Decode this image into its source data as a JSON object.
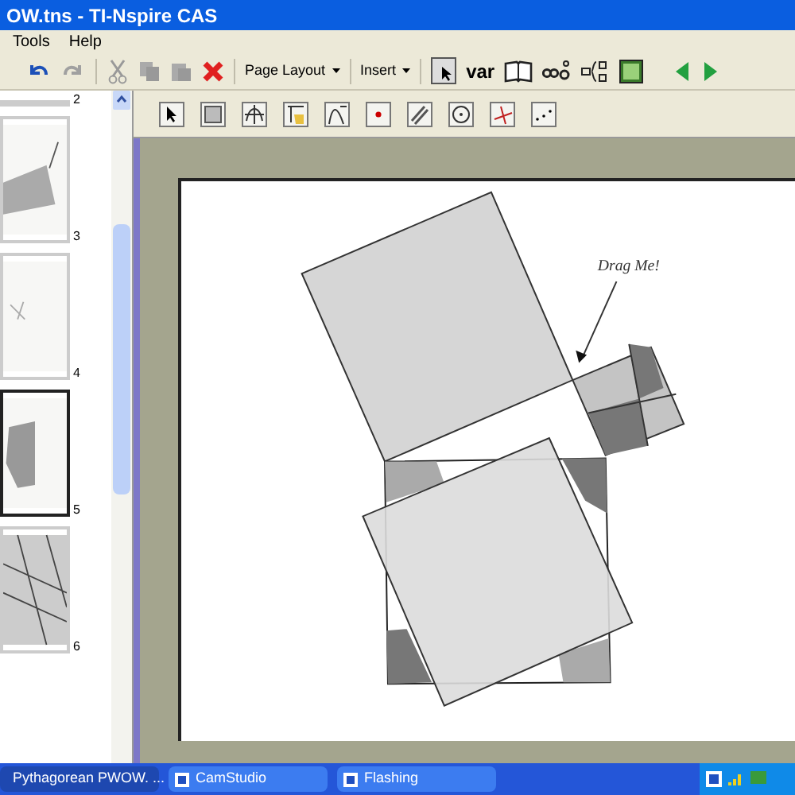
{
  "window": {
    "title": "OW.tns - TI-Nspire CAS"
  },
  "menu": [
    "Tools",
    "Help"
  ],
  "toolbar": {
    "page_layout": "Page Layout",
    "insert": "Insert",
    "var": "var"
  },
  "pages": [
    {
      "number": "2",
      "selected": false
    },
    {
      "number": "3",
      "selected": false
    },
    {
      "number": "4",
      "selected": false
    },
    {
      "number": "5",
      "selected": true
    },
    {
      "number": "6",
      "selected": false
    }
  ],
  "canvas": {
    "label": "Drag Me!"
  },
  "taskbar": [
    {
      "label": "Pythagorean PWOW. ...",
      "selected": true
    },
    {
      "label": "CamStudio",
      "selected": false
    },
    {
      "label": "Flashing",
      "selected": false
    }
  ]
}
